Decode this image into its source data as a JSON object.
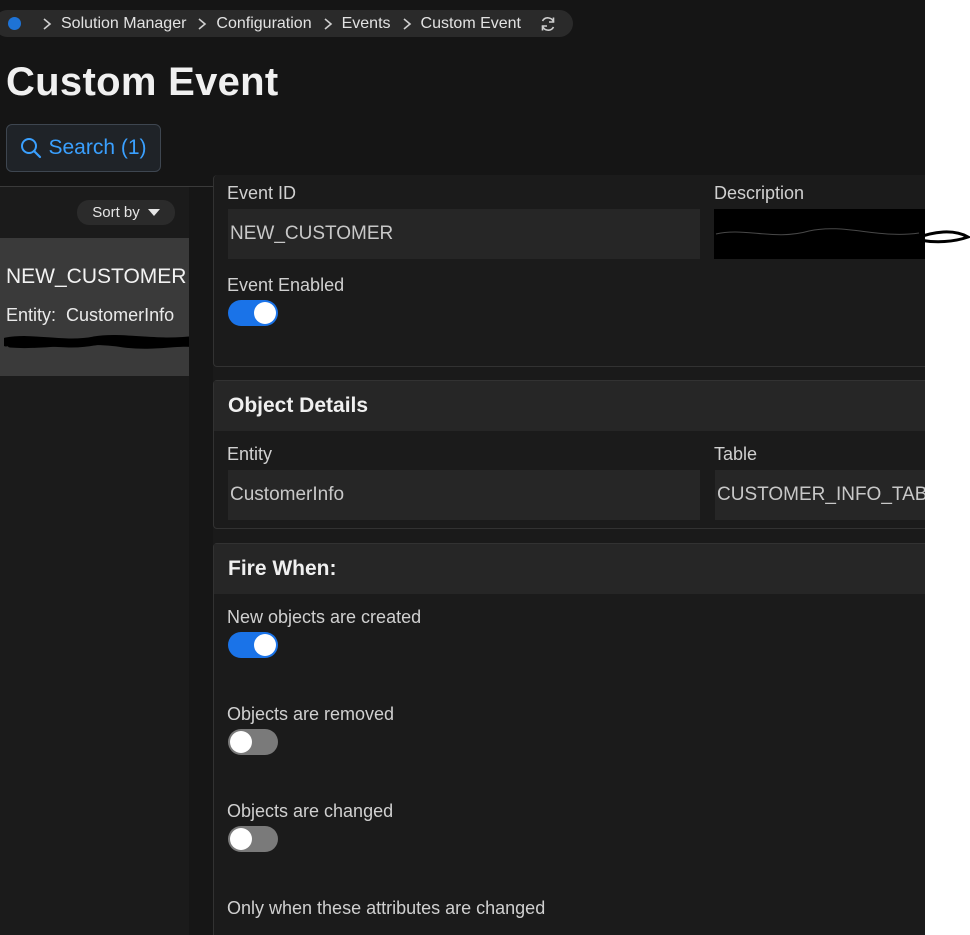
{
  "breadcrumb": {
    "items": [
      "Solution Manager",
      "Configuration",
      "Events",
      "Custom Event"
    ]
  },
  "page": {
    "title": "Custom Event"
  },
  "search": {
    "label": "Search (1)"
  },
  "list": {
    "sort_label": "Sort by",
    "items": [
      {
        "title": "NEW_CUSTOMER",
        "entity_label": "Entity:",
        "entity_value": "CustomerInfo"
      }
    ]
  },
  "event": {
    "id_label": "Event ID",
    "id_value": "NEW_CUSTOMER",
    "description_label": "Description",
    "enabled_label": "Event Enabled",
    "enabled": true
  },
  "object_details": {
    "title": "Object Details",
    "entity_label": "Entity",
    "entity_value": "CustomerInfo",
    "table_label": "Table",
    "table_value": "CUSTOMER_INFO_TAB"
  },
  "fire_when": {
    "title": "Fire When:",
    "created_label": "New objects are created",
    "created": true,
    "removed_label": "Objects are removed",
    "removed": false,
    "changed_label": "Objects are changed",
    "changed": false,
    "attributes_label": "Only when these attributes are changed"
  },
  "colors": {
    "accent": "#1a73e8",
    "link": "#3aa0ff",
    "background": "#1a1a1a",
    "panel_header": "#262626"
  }
}
